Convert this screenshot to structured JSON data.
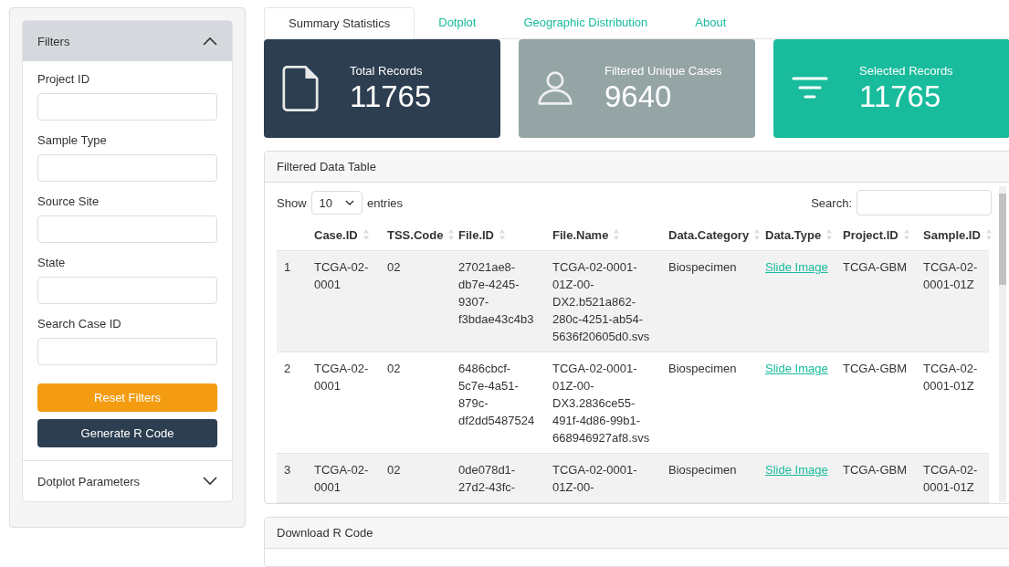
{
  "sidebar": {
    "panels": [
      {
        "title": "Filters",
        "expanded": true,
        "fields": [
          {
            "label": "Project ID"
          },
          {
            "label": "Sample Type"
          },
          {
            "label": "Source Site"
          },
          {
            "label": "State"
          },
          {
            "label": "Search Case ID"
          }
        ],
        "buttons": [
          {
            "label": "Reset Filters",
            "kind": "warning"
          },
          {
            "label": "Generate R Code",
            "kind": "primary"
          }
        ]
      },
      {
        "title": "Dotplot Parameters",
        "expanded": false
      }
    ]
  },
  "tabs": [
    {
      "label": "Summary Statistics",
      "selected": true
    },
    {
      "label": "Dotplot",
      "selected": false
    },
    {
      "label": "Geographic Distribution",
      "selected": false
    },
    {
      "label": "About",
      "selected": false
    }
  ],
  "value_boxes": [
    {
      "label": "Total Records",
      "value": "11765",
      "color": "#2c3e50"
    },
    {
      "label": "Filtered Unique Cases",
      "value": "9640",
      "color": "#95a5a6"
    },
    {
      "label": "Selected Records",
      "value": "11765",
      "color": "#18bc9c"
    }
  ],
  "table_card": {
    "title": "Filtered Data Table",
    "show_label": "Show",
    "page_size": "10",
    "entries_label": "entries",
    "search_label": "Search:",
    "columns": [
      {
        "label": "Case.ID",
        "kind": "text"
      },
      {
        "label": "TSS.Code",
        "kind": "text"
      },
      {
        "label": "File.ID",
        "kind": "text"
      },
      {
        "label": "File.Name",
        "kind": "text"
      },
      {
        "label": "Data.Category",
        "kind": "text"
      },
      {
        "label": "Data.Type",
        "kind": "link"
      },
      {
        "label": "Project.ID",
        "kind": "text"
      },
      {
        "label": "Sample.ID",
        "kind": "text"
      }
    ],
    "rows": [
      {
        "index": "1",
        "cells": [
          "TCGA-02-0001",
          "02",
          "27021ae8-db7e-4245-9307-f3bdae43c4b3",
          "TCGA-02-0001-01Z-00-DX2.b521a862-280c-4251-ab54-5636f20605d0.svs",
          "Biospecimen",
          "Slide Image",
          "TCGA-GBM",
          "TCGA-02-0001-01Z"
        ]
      },
      {
        "index": "2",
        "cells": [
          "TCGA-02-0001",
          "02",
          "6486cbcf-5c7e-4a51-879c-df2dd5487524",
          "TCGA-02-0001-01Z-00-DX3.2836ce55-491f-4d86-99b1-668946927af8.svs",
          "Biospecimen",
          "Slide Image",
          "TCGA-GBM",
          "TCGA-02-0001-01Z"
        ]
      },
      {
        "index": "3",
        "cells": [
          "TCGA-02-0001",
          "02",
          "0de078d1-27d2-43fc-",
          "TCGA-02-0001-01Z-00-",
          "Biospecimen",
          "Slide Image",
          "TCGA-GBM",
          "TCGA-02-0001-01Z"
        ]
      }
    ]
  },
  "download_card": {
    "title": "Download R Code"
  }
}
